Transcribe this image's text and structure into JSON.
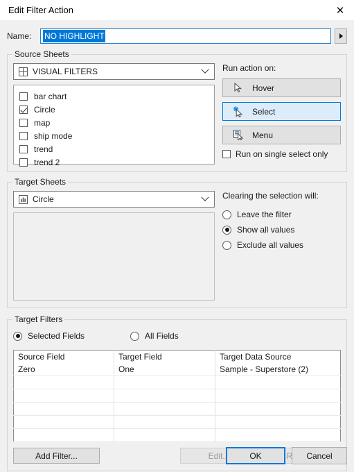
{
  "window": {
    "title": "Edit Filter Action",
    "close_icon": "close-icon"
  },
  "name_row": {
    "label": "Name:",
    "value": "NO HIGHLIGHT",
    "expand_icon": "triangle-right-icon",
    "selection_color": "#0078d7"
  },
  "source_sheets": {
    "title": "Source Sheets",
    "dropdown": {
      "icon": "dashboard-grid-icon",
      "value": "VISUAL FILTERS",
      "chevron_icon": "chevron-down-icon"
    },
    "items": [
      {
        "label": "bar chart",
        "checked": false
      },
      {
        "label": "Circle",
        "checked": true
      },
      {
        "label": "map",
        "checked": false
      },
      {
        "label": "ship mode",
        "checked": false
      },
      {
        "label": "trend",
        "checked": false
      },
      {
        "label": "trend 2",
        "checked": false
      }
    ]
  },
  "run_action": {
    "title": "Run action on:",
    "buttons": [
      {
        "label": "Hover",
        "icon": "cursor-arrow-icon",
        "selected": false
      },
      {
        "label": "Select",
        "icon": "cursor-select-sparkle-icon",
        "selected": true
      },
      {
        "label": "Menu",
        "icon": "cursor-menu-icon",
        "selected": false
      }
    ],
    "single_select_checkbox": {
      "label": "Run on single select only",
      "checked": false
    },
    "selected_accent": "#0078d7",
    "selected_fill": "#dcecfb"
  },
  "target_sheets": {
    "title": "Target Sheets",
    "dropdown": {
      "icon": "worksheet-bar-icon",
      "value": "Circle",
      "chevron_icon": "chevron-down-icon"
    },
    "items": []
  },
  "clearing_selection": {
    "title": "Clearing the selection will:",
    "options": [
      {
        "label": "Leave the filter",
        "selected": false
      },
      {
        "label": "Show all values",
        "selected": true
      },
      {
        "label": "Exclude all values",
        "selected": false
      }
    ]
  },
  "target_filters": {
    "title": "Target Filters",
    "field_mode": [
      {
        "label": "Selected Fields",
        "selected": true
      },
      {
        "label": "All Fields",
        "selected": false
      }
    ],
    "columns": [
      "Source Field",
      "Target Field",
      "Target Data Source"
    ],
    "rows": [
      [
        "Zero",
        "One",
        "Sample - Superstore (2)"
      ]
    ],
    "empty_row_count": 5,
    "buttons": [
      {
        "label": "Add Filter...",
        "enabled": true
      },
      {
        "label": "Edit...",
        "enabled": false
      },
      {
        "label": "Remove",
        "enabled": false
      }
    ]
  },
  "footer": {
    "ok_label": "OK",
    "cancel_label": "Cancel"
  }
}
